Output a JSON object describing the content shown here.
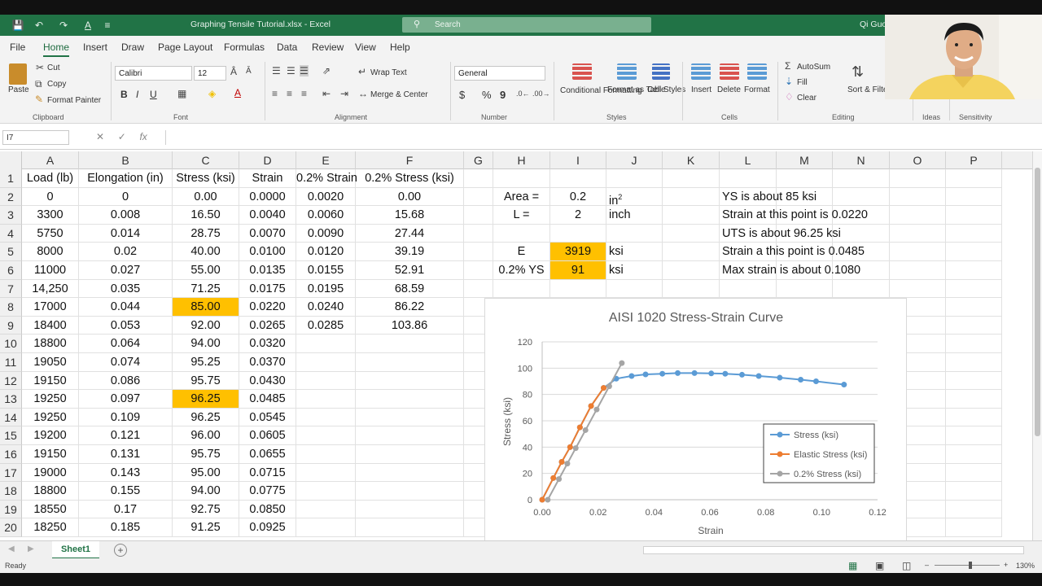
{
  "window": {
    "title": "Graphing Tensile Tutorial.xlsx - Excel",
    "search_placeholder": "Search",
    "user": "Qi Guo"
  },
  "ribbon_tabs": [
    "File",
    "Home",
    "Insert",
    "Draw",
    "Page Layout",
    "Formulas",
    "Data",
    "Review",
    "View",
    "Help"
  ],
  "ribbon": {
    "clipboard": {
      "paste": "Paste",
      "cut": "Cut",
      "copy": "Copy",
      "format_painter": "Format Painter",
      "label": "Clipboard"
    },
    "font": {
      "name": "Calibri",
      "size": "12",
      "bold": "B",
      "italic": "I",
      "underline": "U",
      "label": "Font"
    },
    "alignment": {
      "wrap_text": "Wrap Text",
      "merge_center": "Merge & Center",
      "label": "Alignment"
    },
    "number": {
      "format": "General",
      "currency": "$",
      "percent": "%",
      "comma": "9",
      "label": "Number"
    },
    "styles": {
      "conditional": "Conditional Formatting",
      "format_table": "Format as Table",
      "cell_styles": "Cell Styles",
      "label": "Styles"
    },
    "cells": {
      "insert": "Insert",
      "delete": "Delete",
      "format": "Format",
      "label": "Cells"
    },
    "editing": {
      "autosum": "AutoSum",
      "fill": "Fill",
      "clear": "Clear",
      "sort_filter": "Sort & Filter",
      "find_select": "Find & Select",
      "label": "Editing"
    },
    "ideas": {
      "label": "Ideas"
    },
    "sensitivity": {
      "label": "Sensitivity"
    }
  },
  "formula_bar": {
    "name_box": "I7",
    "formula": ""
  },
  "columns": [
    "A",
    "B",
    "C",
    "D",
    "E",
    "F",
    "G",
    "H",
    "I",
    "J",
    "K",
    "L",
    "M",
    "N",
    "O",
    "P"
  ],
  "rows": [
    "1",
    "2",
    "3",
    "4",
    "5",
    "6",
    "7",
    "8",
    "9",
    "10",
    "11",
    "12",
    "13",
    "14",
    "15",
    "16",
    "17",
    "18",
    "19",
    "20"
  ],
  "table": {
    "headers": [
      "Load (lb)",
      "Elongation (in)",
      "Stress (ksi)",
      "Strain",
      "0.2% Strain",
      "0.2% Stress (ksi)"
    ],
    "rows": [
      [
        "0",
        "0",
        "0.00",
        "0.0000",
        "0.0020",
        "0.00"
      ],
      [
        "3300",
        "0.008",
        "16.50",
        "0.0040",
        "0.0060",
        "15.68"
      ],
      [
        "5750",
        "0.014",
        "28.75",
        "0.0070",
        "0.0090",
        "27.44"
      ],
      [
        "8000",
        "0.02",
        "40.00",
        "0.0100",
        "0.0120",
        "39.19"
      ],
      [
        "11000",
        "0.027",
        "55.00",
        "0.0135",
        "0.0155",
        "52.91"
      ],
      [
        "14,250",
        "0.035",
        "71.25",
        "0.0175",
        "0.0195",
        "68.59"
      ],
      [
        "17000",
        "0.044",
        "85.00",
        "0.0220",
        "0.0240",
        "86.22"
      ],
      [
        "18400",
        "0.053",
        "92.00",
        "0.0265",
        "0.0285",
        "103.86"
      ],
      [
        "18800",
        "0.064",
        "94.00",
        "0.0320",
        "",
        ""
      ],
      [
        "19050",
        "0.074",
        "95.25",
        "0.0370",
        "",
        ""
      ],
      [
        "19150",
        "0.086",
        "95.75",
        "0.0430",
        "",
        ""
      ],
      [
        "19250",
        "0.097",
        "96.25",
        "0.0485",
        "",
        ""
      ],
      [
        "19250",
        "0.109",
        "96.25",
        "0.0545",
        "",
        ""
      ],
      [
        "19200",
        "0.121",
        "96.00",
        "0.0605",
        "",
        ""
      ],
      [
        "19150",
        "0.131",
        "95.75",
        "0.0655",
        "",
        ""
      ],
      [
        "19000",
        "0.143",
        "95.00",
        "0.0715",
        "",
        ""
      ],
      [
        "18800",
        "0.155",
        "94.00",
        "0.0775",
        "",
        ""
      ],
      [
        "18550",
        "0.17",
        "92.75",
        "0.0850",
        "",
        ""
      ],
      [
        "18250",
        "0.185",
        "91.25",
        "0.0925",
        "",
        ""
      ]
    ]
  },
  "side": {
    "area_label": "Area =",
    "area_value": "0.2",
    "area_unit": "in",
    "area_unit_sup": "2",
    "l_label": "L =",
    "l_value": "2",
    "l_unit": "inch",
    "e_label": "E",
    "e_value": "3919",
    "e_unit": "ksi",
    "ys_label": "0.2% YS",
    "ys_value": "91",
    "ys_unit": "ksi",
    "note1": "YS is about 85 ksi",
    "note2": "Strain at this point is 0.0220",
    "note3": "UTS is about 96.25 ksi",
    "note4": "Strain a this point is 0.0485",
    "note5": "Max strain is about 0.1080"
  },
  "highlight_color": "#ffc000",
  "chart_data": {
    "type": "scatter",
    "title": "AISI 1020 Stress-Strain Curve",
    "xlabel": "Strain",
    "ylabel": "Stress (ksi)",
    "xlim": [
      0,
      0.12
    ],
    "ylim": [
      0,
      120
    ],
    "xticks": [
      "0.00",
      "0.02",
      "0.04",
      "0.06",
      "0.08",
      "0.10",
      "0.12"
    ],
    "yticks": [
      "0",
      "20",
      "40",
      "60",
      "80",
      "100",
      "120"
    ],
    "legend_position": "right",
    "series": [
      {
        "name": "Stress (ksi)",
        "color": "#5b9bd5",
        "x": [
          0,
          0.004,
          0.007,
          0.01,
          0.0135,
          0.0175,
          0.022,
          0.0265,
          0.032,
          0.037,
          0.043,
          0.0485,
          0.0545,
          0.0605,
          0.0655,
          0.0715,
          0.0775,
          0.085,
          0.0925,
          0.098,
          0.108
        ],
        "y": [
          0,
          16.5,
          28.75,
          40,
          55,
          71.25,
          85,
          92,
          94,
          95.25,
          95.75,
          96.25,
          96.25,
          96,
          95.75,
          95,
          94,
          92.75,
          91.25,
          90,
          87.5
        ]
      },
      {
        "name": "Elastic Stress (ksi)",
        "color": "#ed7d31",
        "x": [
          0,
          0.004,
          0.007,
          0.01,
          0.0135,
          0.0175,
          0.022
        ],
        "y": [
          0,
          16.5,
          28.75,
          40,
          55,
          71.25,
          85
        ]
      },
      {
        "name": "0.2% Stress (ksi)",
        "color": "#a5a5a5",
        "x": [
          0.002,
          0.006,
          0.009,
          0.012,
          0.0155,
          0.0195,
          0.024,
          0.0285
        ],
        "y": [
          0,
          15.68,
          27.44,
          39.19,
          52.91,
          68.59,
          86.22,
          103.86
        ]
      }
    ]
  },
  "sheet_tab": "Sheet1",
  "status": "Ready",
  "zoom": "130%"
}
